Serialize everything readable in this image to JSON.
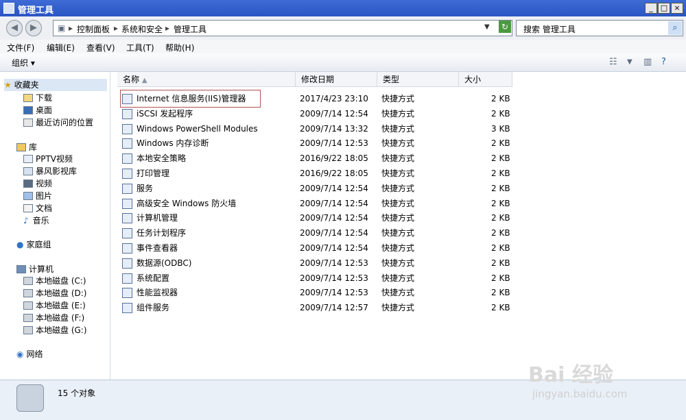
{
  "window": {
    "title": "管理工具",
    "controls": [
      "_",
      "□",
      "×"
    ]
  },
  "address": {
    "crumbs": [
      "控制面板",
      "系统和安全",
      "管理工具"
    ],
    "search_placeholder": "搜索 管理工具"
  },
  "menu": [
    "文件(F)",
    "编辑(E)",
    "查看(V)",
    "工具(T)",
    "帮助(H)"
  ],
  "toolbar": {
    "organize": "组织"
  },
  "nav": {
    "favorites": {
      "title": "收藏夹",
      "items": [
        "下载",
        "桌面",
        "最近访问的位置"
      ]
    },
    "library": {
      "title": "库",
      "items": [
        "PPTV视频",
        "暴风影视库",
        "视频",
        "图片",
        "文档",
        "音乐"
      ]
    },
    "homegroup": "家庭组",
    "computer": {
      "title": "计算机",
      "items": [
        "本地磁盘 (C:)",
        "本地磁盘 (D:)",
        "本地磁盘 (E:)",
        "本地磁盘 (F:)",
        "本地磁盘 (G:)"
      ]
    },
    "network": "网络"
  },
  "columns": {
    "name": "名称",
    "date": "修改日期",
    "type": "类型",
    "size": "大小"
  },
  "files": [
    {
      "name": "Internet 信息服务(IIS)管理器",
      "date": "2017/4/23 23:10",
      "type": "快捷方式",
      "size": "2 KB"
    },
    {
      "name": "iSCSI 发起程序",
      "date": "2009/7/14 12:54",
      "type": "快捷方式",
      "size": "2 KB"
    },
    {
      "name": "Windows PowerShell Modules",
      "date": "2009/7/14 13:32",
      "type": "快捷方式",
      "size": "3 KB"
    },
    {
      "name": "Windows 内存诊断",
      "date": "2009/7/14 12:53",
      "type": "快捷方式",
      "size": "2 KB"
    },
    {
      "name": "本地安全策略",
      "date": "2016/9/22 18:05",
      "type": "快捷方式",
      "size": "2 KB"
    },
    {
      "name": "打印管理",
      "date": "2016/9/22 18:05",
      "type": "快捷方式",
      "size": "2 KB"
    },
    {
      "name": "服务",
      "date": "2009/7/14 12:54",
      "type": "快捷方式",
      "size": "2 KB"
    },
    {
      "name": "高级安全 Windows 防火墙",
      "date": "2009/7/14 12:54",
      "type": "快捷方式",
      "size": "2 KB"
    },
    {
      "name": "计算机管理",
      "date": "2009/7/14 12:54",
      "type": "快捷方式",
      "size": "2 KB"
    },
    {
      "name": "任务计划程序",
      "date": "2009/7/14 12:54",
      "type": "快捷方式",
      "size": "2 KB"
    },
    {
      "name": "事件查看器",
      "date": "2009/7/14 12:54",
      "type": "快捷方式",
      "size": "2 KB"
    },
    {
      "name": "数据源(ODBC)",
      "date": "2009/7/14 12:53",
      "type": "快捷方式",
      "size": "2 KB"
    },
    {
      "name": "系统配置",
      "date": "2009/7/14 12:53",
      "type": "快捷方式",
      "size": "2 KB"
    },
    {
      "name": "性能监视器",
      "date": "2009/7/14 12:53",
      "type": "快捷方式",
      "size": "2 KB"
    },
    {
      "name": "组件服务",
      "date": "2009/7/14 12:57",
      "type": "快捷方式",
      "size": "2 KB"
    }
  ],
  "status": {
    "count_text": "15 个对象"
  },
  "watermark": {
    "brand": "Bai 经验",
    "site": "jingyan.baidu.com"
  }
}
